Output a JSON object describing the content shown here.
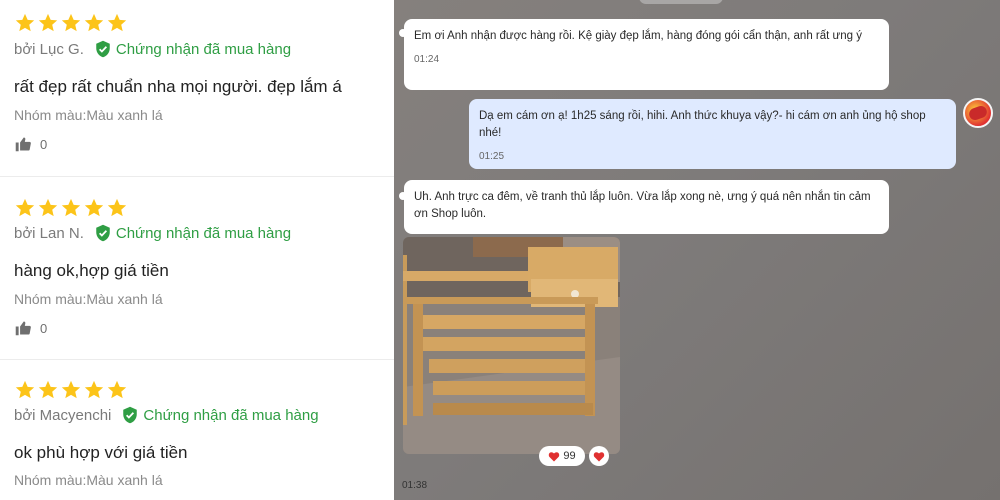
{
  "reviews": [
    {
      "stars": 5,
      "author": "bởi Lục G.",
      "verified": "Chứng nhận đã mua hàng",
      "comment": "rất đẹp rất chuẩn nha mọi người. đẹp lắm á",
      "variant": "Nhóm màu:Màu xanh lá",
      "likes": "0"
    },
    {
      "stars": 5,
      "author": "bởi Lan N.",
      "verified": "Chứng nhận đã mua hàng",
      "comment": "hàng ok,hợp giá tiền",
      "variant": "Nhóm màu:Màu xanh lá",
      "likes": "0"
    },
    {
      "stars": 5,
      "author": "bởi Macyenchi",
      "verified": "Chứng nhận đã mua hàng",
      "comment": "ok phù hợp với giá tiền",
      "variant": "Nhóm màu:Màu xanh lá"
    }
  ],
  "colors": {
    "star": "#fcc419",
    "verified": "#2f9e44",
    "thumb": "#6f6f6f"
  },
  "icons": {
    "star": "star-icon",
    "verified": "check-shield-icon",
    "like": "thumbs-up-icon",
    "heart": "heart-icon"
  },
  "chat": {
    "messages": [
      {
        "side": "left",
        "text": "Em ơi Anh nhận được hàng rồi. Kệ giày đẹp lắm, hàng đóng gói cẩn thận, anh rất ưng ý",
        "time": "01:24"
      },
      {
        "side": "right",
        "text": "Dạ em cám ơn ạ! 1h25 sáng rồi, hihi. Anh thức khuya vậy?- hi cám ơn anh ủng hộ shop nhé!",
        "time": "01:25"
      },
      {
        "side": "left",
        "text": "Uh. Anh trực ca đêm, về tranh thủ lắp luôn. Vừa lắp xong nè, ưng ý quá nên nhắn tin cảm ơn Shop luôn."
      }
    ],
    "photo_alt": "photo-of-wooden-shoe-rack",
    "reaction_count": "99",
    "bottom_time": "01:38"
  }
}
